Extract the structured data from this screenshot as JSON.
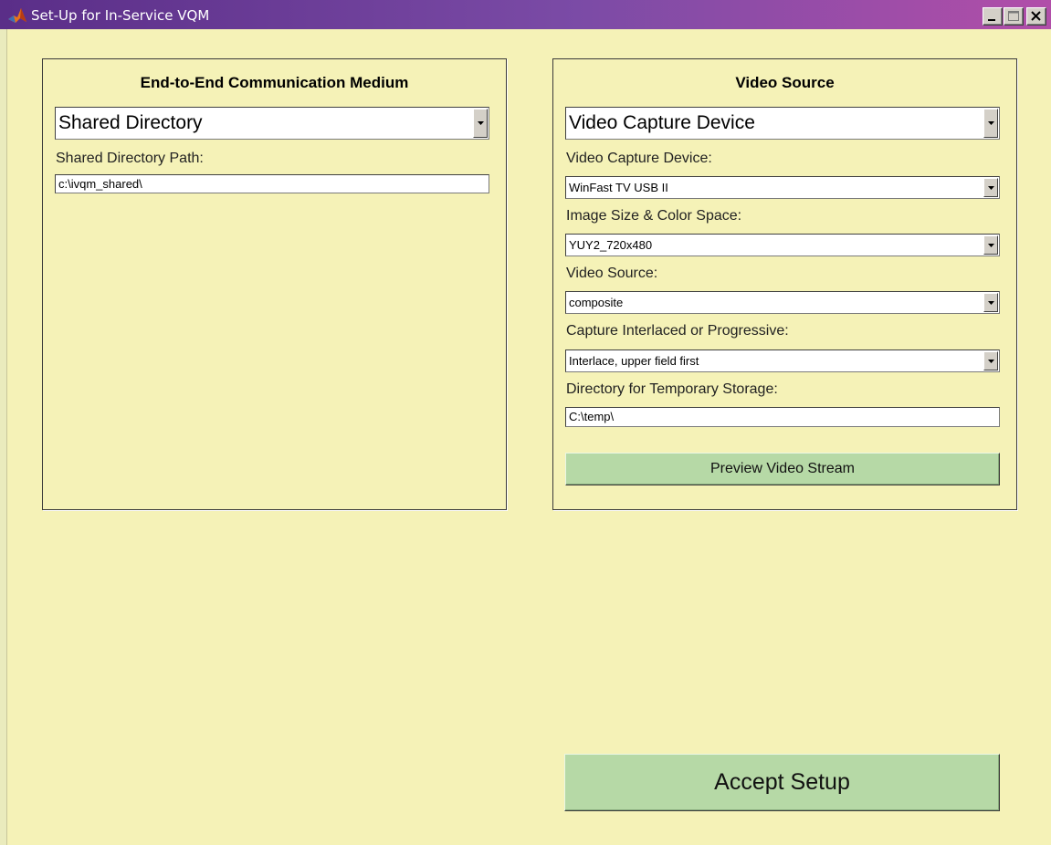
{
  "window": {
    "title": "Set-Up for In-Service VQM",
    "controls": [
      "minimize-icon",
      "maximize-icon",
      "close-icon"
    ]
  },
  "left_panel": {
    "title": "End-to-End Communication Medium",
    "medium_select": "Shared Directory",
    "path_label": "Shared Directory Path:",
    "path_value": "c:\\ivqm_shared\\"
  },
  "right_panel": {
    "title": "Video Source",
    "source_select": "Video Capture Device",
    "device_label": "Video Capture Device:",
    "device_value": "WinFast TV USB II",
    "size_label": "Image Size & Color Space:",
    "size_value": "YUY2_720x480",
    "video_source_label": "Video Source:",
    "video_source_value": "composite",
    "interlace_label": "Capture Interlaced or Progressive:",
    "interlace_value": "Interlace, upper field first",
    "temp_dir_label": "Directory for Temporary Storage:",
    "temp_dir_value": "C:\\temp\\",
    "preview_button": "Preview Video Stream"
  },
  "accept_button": "Accept Setup",
  "colors": {
    "background": "#f5f2b7",
    "button": "#b6d9a6",
    "titlebar_start": "#5a2e88",
    "titlebar_end": "#b14ea9"
  }
}
